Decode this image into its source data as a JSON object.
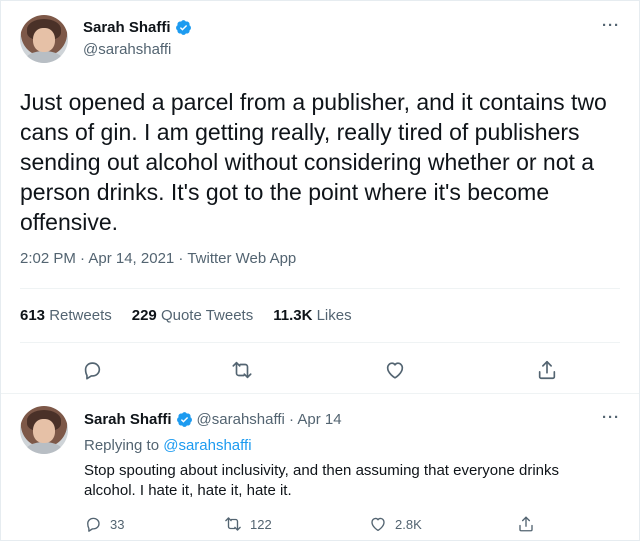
{
  "tweet": {
    "author_name": "Sarah Shaffi",
    "author_handle": "@sarahshaffi",
    "more_label": "···",
    "text": "Just opened a parcel from a publisher, and it contains two cans of gin. I am getting really, really tired of publishers sending out alcohol without considering whether or not a person drinks. It's got to the point where it's become offensive.",
    "timestamp": "2:02 PM · Apr 14, 2021 · Twitter Web App",
    "stats": {
      "retweets_count": "613",
      "retweets_label": "Retweets",
      "quote_count": "229",
      "quote_label": "Quote Tweets",
      "likes_count": "11.3K",
      "likes_label": "Likes"
    },
    "actions": [
      "reply-icon",
      "retweet-icon",
      "like-icon",
      "share-icon"
    ]
  },
  "reply": {
    "author_name": "Sarah Shaffi",
    "author_handle_time": "@sarahshaffi · Apr 14",
    "more_label": "···",
    "replying_prefix": "Replying to",
    "replying_handle": "@sarahshaffi",
    "text": "Stop spouting about inclusivity, and then assuming that everyone drinks alcohol. I hate it, hate it, hate it.",
    "counts": {
      "replies": "33",
      "retweets": "122",
      "likes": "2.8K"
    }
  },
  "colors": {
    "accent": "#1d9bf0",
    "secondary_text": "#536471",
    "primary_text": "#0f1419"
  }
}
